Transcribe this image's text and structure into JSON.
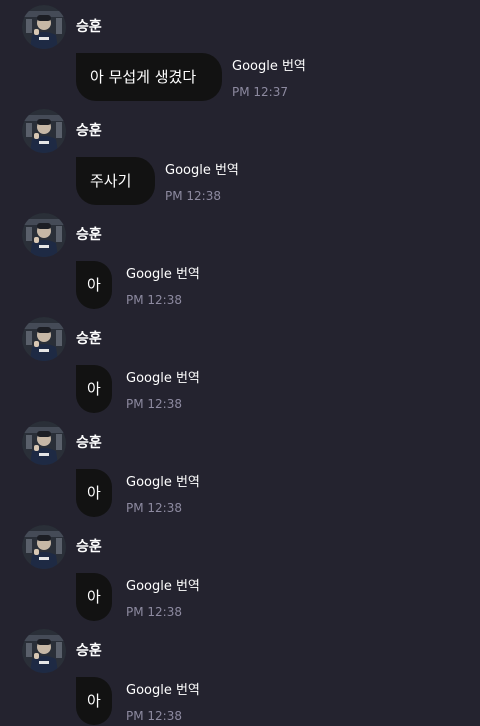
{
  "messages": [
    {
      "sender": "승훈",
      "text": "아 무섭게 생겼다",
      "translate_label": "Google 번역",
      "time": "PM 12:37"
    },
    {
      "sender": "승훈",
      "text": "주사기",
      "translate_label": "Google 번역",
      "time": "PM 12:38"
    },
    {
      "sender": "승훈",
      "text": "아",
      "translate_label": "Google 번역",
      "time": "PM 12:38"
    },
    {
      "sender": "승훈",
      "text": "아",
      "translate_label": "Google 번역",
      "time": "PM 12:38"
    },
    {
      "sender": "승훈",
      "text": "아",
      "translate_label": "Google 번역",
      "time": "PM 12:38"
    },
    {
      "sender": "승훈",
      "text": "아",
      "translate_label": "Google 번역",
      "time": "PM 12:38"
    },
    {
      "sender": "승훈",
      "text": "아",
      "translate_label": "Google 번역",
      "time": "PM 12:38"
    }
  ],
  "colors": {
    "background": "#24232f",
    "bubble": "#121212",
    "text": "#ffffff",
    "timestamp": "#8d8aa0"
  },
  "icons": {
    "avatar": "user-photo-avatar"
  }
}
